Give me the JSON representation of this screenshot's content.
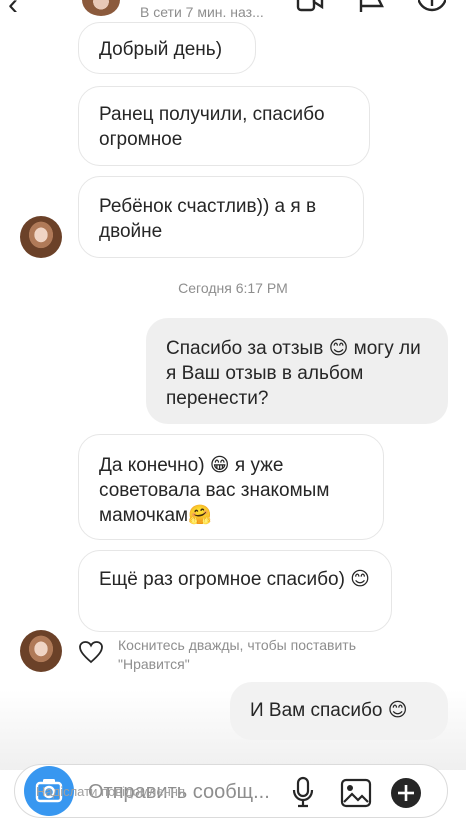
{
  "header": {
    "status": "В сети 7 мин. наз..."
  },
  "messages": [
    {
      "id": "m1",
      "direction": "in",
      "text": "Добрый день)"
    },
    {
      "id": "m2",
      "direction": "in",
      "text": "Ранец получили, спасибо огромное"
    },
    {
      "id": "m3",
      "direction": "in",
      "text": "Ребёнок счастлив)) а я в двойне"
    },
    {
      "id": "m4",
      "direction": "out",
      "text": "Спасибо за отзыв 😊 могу ли я Ваш отзыв в альбом перенести?"
    },
    {
      "id": "m5",
      "direction": "in",
      "text": "Да конечно) 😁 я уже советовала вас знакомым мамочкам🤗"
    },
    {
      "id": "m6",
      "direction": "in",
      "text": "Ещё раз огромное спасибо) 😊"
    },
    {
      "id": "m7",
      "direction": "out",
      "text": "И Вам спасибо 😊"
    }
  ],
  "timestamp": "Сегодня 6:17 PM",
  "like_hint": "Коснитесь дважды, чтобы поставить \"Нравится\"",
  "composer": {
    "placeholder": "Отправить сообщ...",
    "overlay_text": "Надіслати повідомлення"
  },
  "icons": {
    "back": "back-arrow-icon",
    "video": "video-call-icon",
    "flag": "flag-icon",
    "info": "info-icon",
    "camera": "camera-icon",
    "mic": "microphone-icon",
    "gallery": "gallery-icon",
    "plus": "plus-icon",
    "heart": "heart-icon"
  },
  "colors": {
    "accent": "#3897f0",
    "incoming_bubble": "#ffffff",
    "outgoing_bubble": "#efefef",
    "muted_text": "#8e8e8e"
  }
}
